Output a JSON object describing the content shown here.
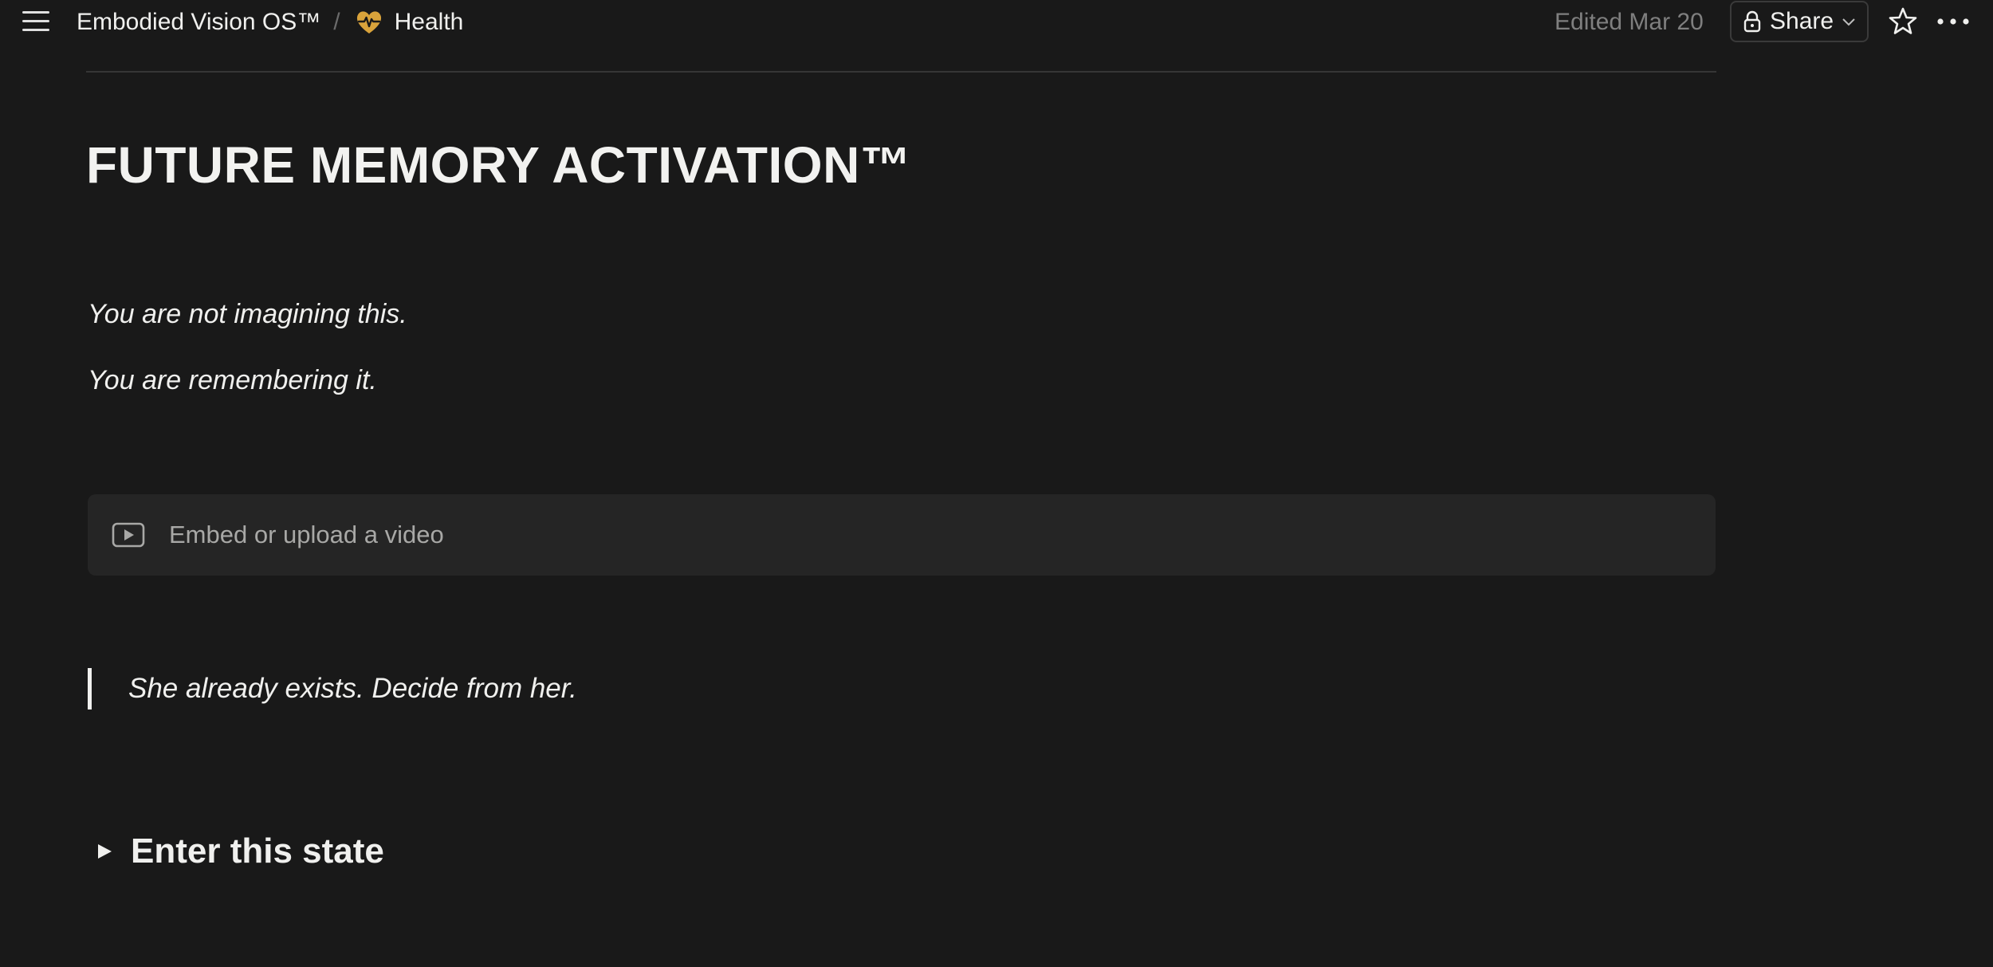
{
  "topbar": {
    "breadcrumb": {
      "parent": "Embodied Vision OS™",
      "separator": "/",
      "current": "Health",
      "current_icon": "heart-pulse-icon"
    },
    "edited": "Edited Mar 20",
    "share_label": "Share",
    "icons": {
      "menu": "hamburger-menu-icon",
      "lock": "lock-icon",
      "chevron": "chevron-down-icon",
      "favorite": "star-icon",
      "more": "more-horizontal-icon"
    }
  },
  "page": {
    "title": "FUTURE MEMORY ACTIVATION™",
    "paragraphs": [
      "You are not imagining this.",
      "You are remembering it."
    ],
    "video_placeholder": "Embed or upload a video",
    "quote": "She already exists. Decide from her.",
    "toggle_heading": "Enter this state"
  },
  "colors": {
    "background": "#191919",
    "text": "#f0f0ee",
    "muted": "#7f7f7f",
    "accent_icon": "#d9a33b",
    "block": "#252525"
  }
}
